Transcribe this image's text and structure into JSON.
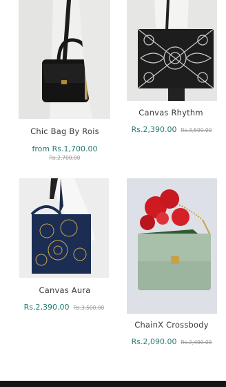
{
  "products": [
    {
      "name": "Chic Bag By Rois",
      "price": "from Rs.1,700.00",
      "old_price": "Rs.2,700.00"
    },
    {
      "name": "Canvas Rhythm",
      "price": "Rs.2,390.00",
      "old_price": "Rs.3,500.00"
    },
    {
      "name": "Canvas Aura",
      "price": "Rs.2,390.00",
      "old_price": "Rs.3,500.00"
    },
    {
      "name": "ChainX Crossbody",
      "price": "Rs.2,090.00",
      "old_price": "Rs.2,400.00"
    }
  ],
  "icons": {
    "card1": "black-handbag-photo",
    "card2": "bandana-tote-photo",
    "card3": "blue-canvas-tote-photo",
    "card4": "green-crossbody-with-roses-photo"
  }
}
